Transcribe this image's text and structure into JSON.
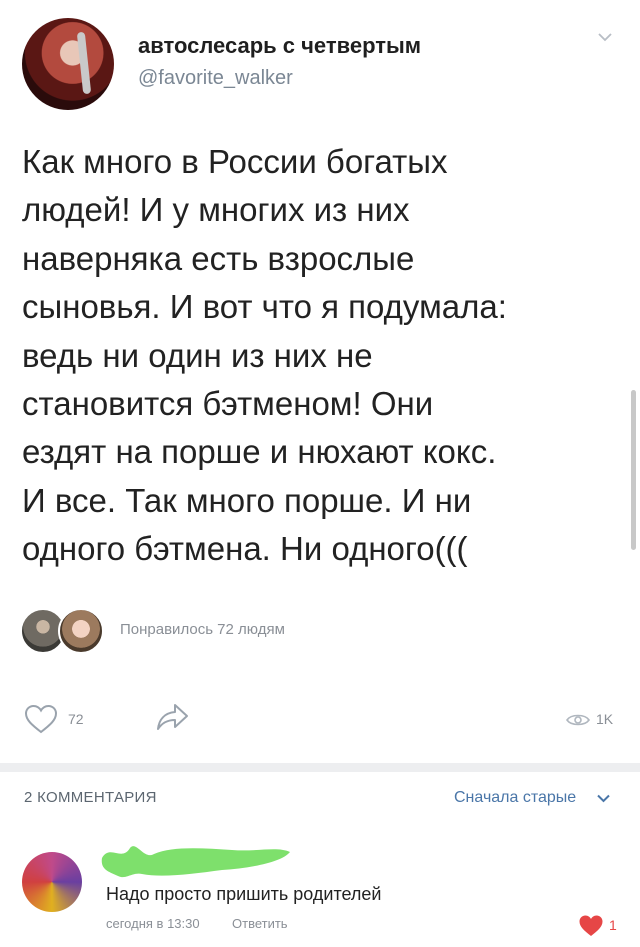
{
  "post": {
    "author_name": "автослесарь с четвертым",
    "author_handle": "@favorite_walker",
    "text": "Как много в России богатых\nлюдей! И у многих из них\nнаверняка есть взрослые\nсыновья. И вот что я подумала:\nведь ни один из них не\nстановится бэтменом! Они\nездят на порше и нюхают кокс.\nИ все. Так много порше. И ни\nодного бэтмена. Ни одного(((",
    "likers_text": "Понравилось 72 людям"
  },
  "actions": {
    "like_count": "72",
    "views_count": "1K",
    "like_icon": "heart-outline-icon",
    "share_icon": "share-arrow-icon",
    "views_icon": "eye-icon"
  },
  "comments": {
    "count_label": "2 КОММЕНТАРИЯ",
    "sort_label": "Сначала старые",
    "items": [
      {
        "text": "Надо просто пришить родителей",
        "time": "сегодня в 13:30",
        "reply_label": "Ответить",
        "likes": "1"
      }
    ]
  },
  "colors": {
    "accent_blue": "#4a76a8",
    "meta_gray": "#8a8f96",
    "liked_red": "#e64646",
    "scribble_green": "#7ee06c"
  }
}
